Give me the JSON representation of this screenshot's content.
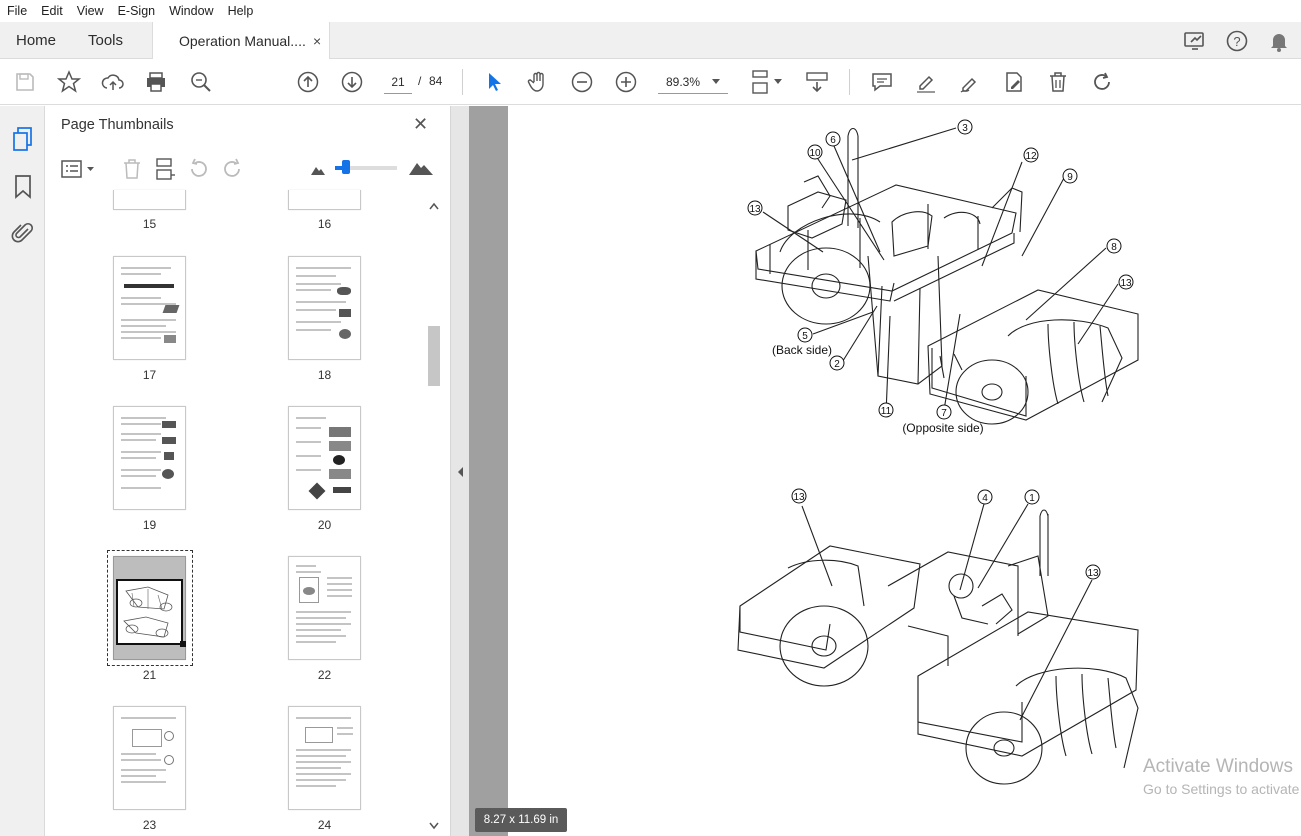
{
  "menu": {
    "file": "File",
    "edit": "Edit",
    "view": "View",
    "esign": "E-Sign",
    "window": "Window",
    "help": "Help"
  },
  "tabs": {
    "home": "Home",
    "tools": "Tools",
    "document": "Operation Manual....",
    "close": "×"
  },
  "toolbar": {
    "page_current": "21",
    "page_sep": "/",
    "page_total": "84",
    "zoom": "89.3%"
  },
  "panel": {
    "title": "Page Thumbnails",
    "close": "✕"
  },
  "thumbnails": {
    "p15": "15",
    "p16": "16",
    "p17": "17",
    "p18": "18",
    "p19": "19",
    "p20": "20",
    "p21": "21",
    "p22": "22",
    "p23": "23",
    "p24": "24"
  },
  "figure": {
    "labels_top": [
      "③",
      "⑥",
      "⑩",
      "⑫",
      "⑨",
      "⑬",
      "⑧",
      "⑬",
      "⑤",
      "②",
      "⑪",
      "⑦"
    ],
    "back_side": "(Back side)",
    "opposite_side": "(Opposite side)",
    "labels_bottom": [
      "⑬",
      "④",
      "①",
      "⑬"
    ]
  },
  "status": {
    "page_size": "8.27 x 11.69 in"
  },
  "watermark": {
    "line1": "Activate Windows",
    "line2": "Go to Settings to activate Windows."
  },
  "colors": {
    "accent": "#1473e6",
    "chrome": "#f0f0f0",
    "doc_bg": "#a0a0a0"
  }
}
